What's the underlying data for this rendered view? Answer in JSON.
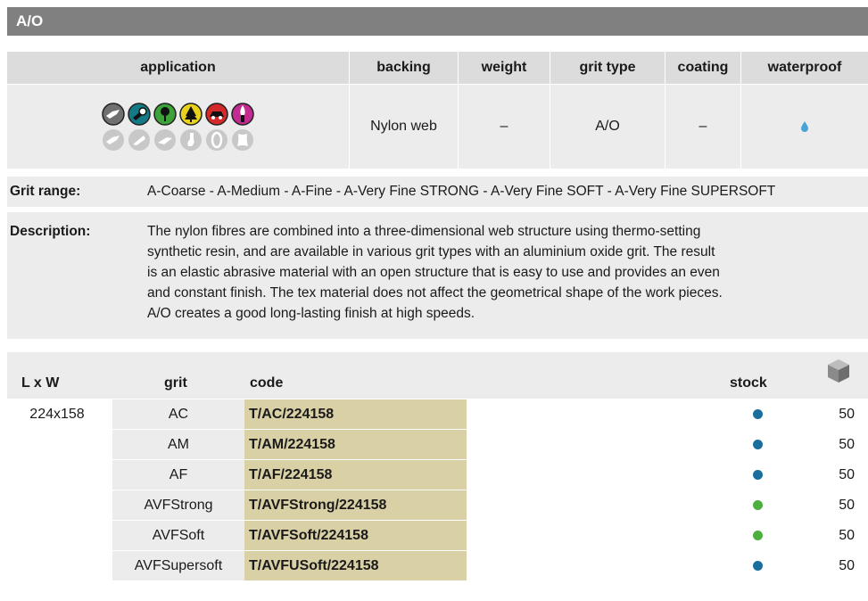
{
  "title": "A/O",
  "spec": {
    "headers": [
      "application",
      "backing",
      "weight",
      "grit type",
      "coating",
      "waterproof"
    ],
    "backing": "Nylon web",
    "weight": "–",
    "grit_type": "A/O",
    "coating": "–",
    "waterproof_icon": "water-drop-icon",
    "application_icons_row1": [
      "metal-icon",
      "pipe-icon",
      "wood-icon",
      "tree-icon",
      "car-icon",
      "paint-brush-icon"
    ],
    "application_icons_row2": [
      "stainless-icon",
      "composite-icon",
      "stone-icon",
      "filler-icon",
      "disc-icon",
      "leather-icon"
    ]
  },
  "grit_range": {
    "label": "Grit range:",
    "value": "A-Coarse - A-Medium - A-Fine - A-Very Fine STRONG - A-Very Fine SOFT - A-Very Fine SUPERSOFT"
  },
  "description": {
    "label": "Description:",
    "lines": [
      "The nylon fibres are combined into a three-dimensional web structure using thermo-setting",
      "synthetic resin, and are available in various grit types with an aluminium oxide grit. The result",
      "is an elastic abrasive material with an open structure that is easy to use and provides an even",
      "and constant finish. The tex material does not affect the geometrical shape of the work pieces.",
      "A/O creates a good long-lasting finish at high speeds."
    ]
  },
  "products": {
    "headers": {
      "lw": "L  x  W",
      "grit": "grit",
      "code": "code",
      "stock": "stock"
    },
    "stock_icon": "box-icon",
    "rows": [
      {
        "lw": "224x158",
        "grit": "AC",
        "code": "T/AC/224158",
        "stock_color": "#1a6e9e",
        "qty": "50"
      },
      {
        "lw": "",
        "grit": "AM",
        "code": "T/AM/224158",
        "stock_color": "#1a6e9e",
        "qty": "50"
      },
      {
        "lw": "",
        "grit": "AF",
        "code": "T/AF/224158",
        "stock_color": "#1a6e9e",
        "qty": "50"
      },
      {
        "lw": "",
        "grit": "AVFStrong",
        "code": "T/AVFStrong/224158",
        "stock_color": "#4caf3e",
        "qty": "50"
      },
      {
        "lw": "",
        "grit": "AVFSoft",
        "code": "T/AVFSoft/224158",
        "stock_color": "#4caf3e",
        "qty": "50"
      },
      {
        "lw": "",
        "grit": "AVFSupersoft",
        "code": "T/AVFUSoft/224158",
        "stock_color": "#1a6e9e",
        "qty": "50"
      }
    ]
  }
}
